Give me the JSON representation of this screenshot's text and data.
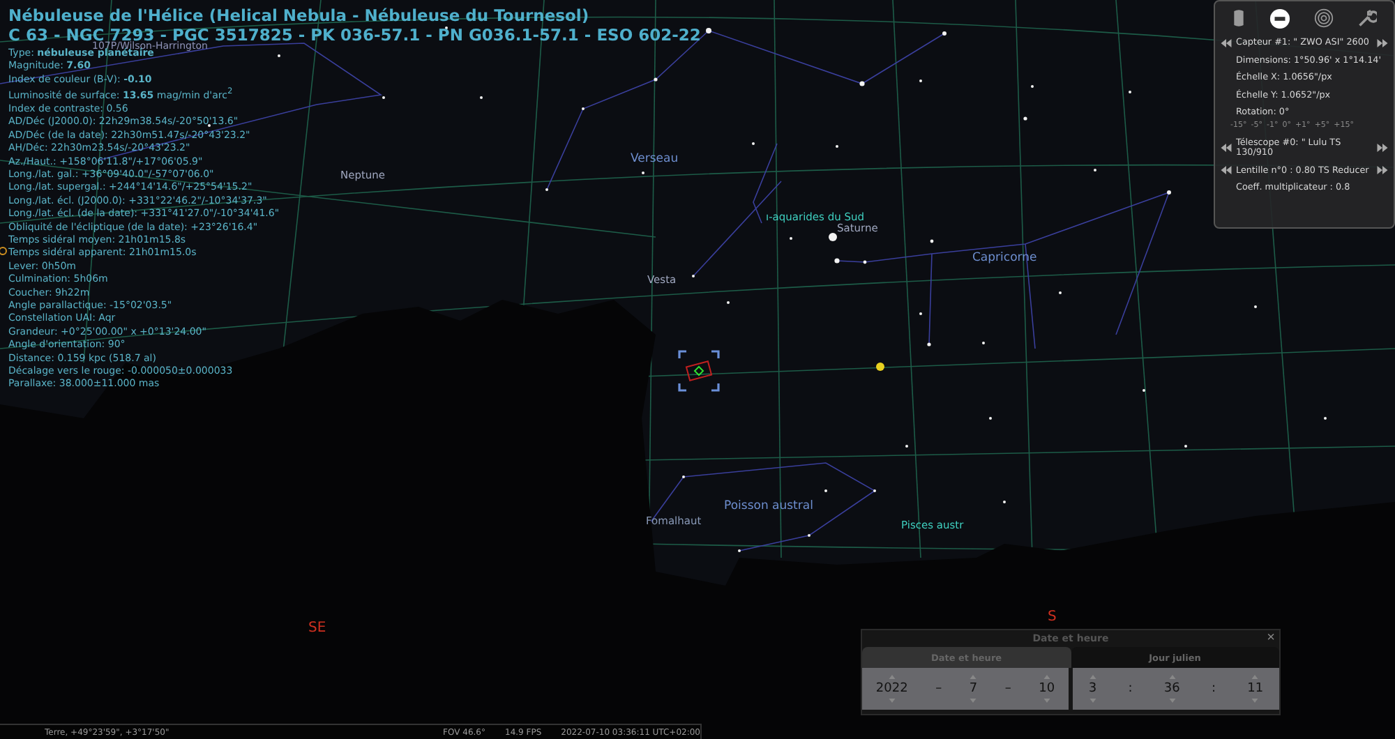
{
  "info": {
    "title": "Nébuleuse de l'Hélice (Helical Nebula - Nébuleuse du Tournesol)",
    "designations": "C 63 - NGC 7293 - PGC 3517825 - PK 036-57.1 - PN G036.1-57.1 - ESO 602-22",
    "lines": [
      "Type: **nébuleuse planétaire**",
      "Magnitude: **7.60**",
      "Index de couleur (B-V): **-0.10**",
      "Luminosité de surface: **13.65** mag/min d'arc$^{2}$",
      "Index de contraste: 0.56",
      "AD/Déc (J2000.0): 22h29m38.54s/-20°50'13.6\"",
      "AD/Déc (de la date): 22h30m51.47s/-20°43'23.2\"",
      "AH/Déc: 22h30m23.54s/-20°43'23.2\"",
      "Az./Haut.: +158°06'11.8\"/+17°06'05.9\"",
      "Long./lat. gal.: +36°09'40.0\"/-57°07'06.0\"",
      "Long./lat. supergal.: +244°14'14.6\"/+25°54'15.2\"",
      "Long./lat. écl. (J2000.0): +331°22'46.2\"/-10°34'37.3\"",
      "Long./lat. écl. (de la date): +331°41'27.0\"/-10°34'41.6\"",
      "Obliquité de l'écliptique (de la date): +23°26'16.4\"",
      "Temps sidéral moyen: 21h01m15.8s",
      "Temps sidéral apparent: 21h01m15.0s",
      "Lever: 0h50m",
      "Culmination: 5h06m",
      "Coucher: 9h22m",
      "Angle parallactique: -15°02'03.5\"",
      "Constellation UAI: Aqr",
      "Grandeur: +0°25'00.00\" x +0°13'24.00\"",
      "Angle d'orientation: 90°",
      "Distance: 0.159 kpc (518.7 al)",
      "Décalage vers le rouge: -0.000050±0.000033",
      "Parallaxe: 38.000±11.000 mas"
    ]
  },
  "sky_labels": [
    {
      "text": "107P/Wilson-Harrington",
      "kind": "comet"
    },
    {
      "text": "Neptune",
      "kind": "planet"
    },
    {
      "text": "Verseau",
      "kind": "constellation"
    },
    {
      "text": "ı-aquarides du Sud",
      "kind": "meteor"
    },
    {
      "text": "Saturne",
      "kind": "planet"
    },
    {
      "text": "Capricorne",
      "kind": "constellation"
    },
    {
      "text": "Vesta",
      "kind": "planet"
    },
    {
      "text": "Poisson austral",
      "kind": "constellation"
    },
    {
      "text": "Fomalhaut",
      "kind": "star"
    },
    {
      "text": "Pisces austr",
      "kind": "meteor"
    },
    {
      "text": "SE",
      "kind": "cardinal"
    },
    {
      "text": "S",
      "kind": "cardinal"
    }
  ],
  "oculars": {
    "tools": [
      {
        "kind": "eyepiece",
        "selected": false
      },
      {
        "kind": "sensor",
        "selected": true
      },
      {
        "kind": "telrad",
        "selected": false
      },
      {
        "kind": "settings",
        "selected": false
      }
    ],
    "rows": [
      {
        "kind": "nav",
        "text": "Capteur #1: \" ZWO ASI\" 2600"
      },
      {
        "kind": "text",
        "text": "Dimensions: 1°50.96' x 1°14.14'"
      },
      {
        "kind": "text",
        "text": "Échelle X: 1.0656\"/px"
      },
      {
        "kind": "text",
        "text": "Échelle Y: 1.0652\"/px"
      },
      {
        "kind": "text",
        "text": "Rotation: 0°"
      },
      {
        "kind": "rotation",
        "steps": [
          "-15°",
          "-5°",
          "-1°",
          "0°",
          "+1°",
          "+5°",
          "+15°"
        ]
      },
      {
        "kind": "nav",
        "text": "Télescope #0: \" Lulu TS 130/910"
      },
      {
        "kind": "nav",
        "text": "Lentille n°0 : 0.80 TS Reducer"
      },
      {
        "kind": "text",
        "text": "Coeff. multiplicateur : 0.8"
      }
    ]
  },
  "date_dialog": {
    "title": "Date et heure",
    "close": "×",
    "tabs": [
      {
        "label": "Date et heure",
        "selected": true
      },
      {
        "label": "Jour julien",
        "selected": false
      }
    ],
    "date": [
      {
        "kind": "spin",
        "value": "2022"
      },
      {
        "kind": "sep",
        "value": "–"
      },
      {
        "kind": "spin",
        "value": "7"
      },
      {
        "kind": "sep",
        "value": "–"
      },
      {
        "kind": "spin",
        "value": "10"
      }
    ],
    "time": [
      {
        "kind": "spin",
        "value": "3"
      },
      {
        "kind": "sep",
        "value": ":"
      },
      {
        "kind": "spin",
        "value": "36"
      },
      {
        "kind": "sep",
        "value": ":"
      },
      {
        "kind": "spin",
        "value": "11"
      }
    ]
  },
  "status_bar": {
    "location": "Terre, +49°23'59\", +3°17'50\"",
    "fov": "FOV 46.6°",
    "fps": "14.9 FPS",
    "datetime": "2022-07-10 03:36:11 UTC+02:00"
  }
}
